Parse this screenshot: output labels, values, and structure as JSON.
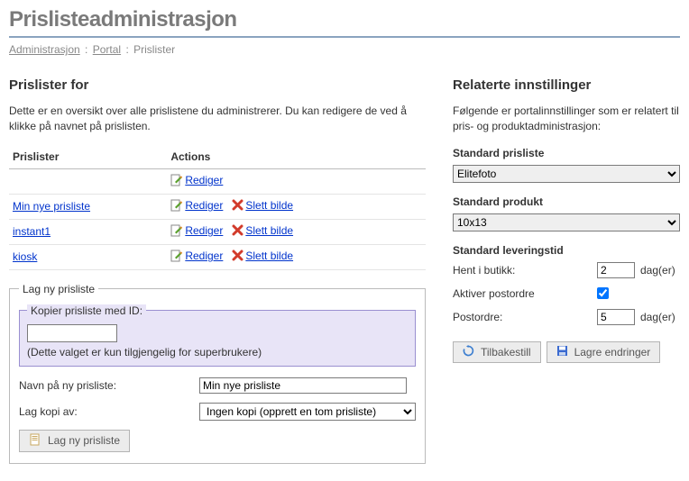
{
  "page_title": "Prislisteadministrasjon",
  "breadcrumb": {
    "admin": "Administrasjon",
    "portal": "Portal",
    "current": "Prislister"
  },
  "left": {
    "heading": "Prislister for",
    "intro": "Dette er en oversikt over alle prislistene du administrerer. Du kan redigere de ved å klikke på navnet på prislisten.",
    "table": {
      "col_name": "Prislister",
      "col_actions": "Actions",
      "rows": [
        {
          "name": "",
          "edit": "Rediger",
          "del": ""
        },
        {
          "name": "Min nye prisliste",
          "edit": "Rediger",
          "del": "Slett bilde"
        },
        {
          "name": "instant1",
          "edit": "Rediger",
          "del": "Slett bilde"
        },
        {
          "name": "kiosk",
          "edit": "Rediger",
          "del": "Slett bilde"
        }
      ]
    },
    "new_fieldset": {
      "legend": "Lag ny prisliste",
      "copy_legend": "Kopier prisliste med ID:",
      "copy_value": "",
      "copy_note": "(Dette valget er kun tilgjengelig for superbrukere)",
      "name_label": "Navn på ny prisliste:",
      "name_value": "Min nye prisliste",
      "copyof_label": "Lag kopi av:",
      "copyof_value": "Ingen kopi (opprett en tom prisliste)",
      "submit": "Lag ny prisliste"
    }
  },
  "right": {
    "heading": "Relaterte innstillinger",
    "intro": "Følgende er portalinnstillinger som er relatert til pris- og produktadministrasjon:",
    "std_pricelist_label": "Standard prisliste",
    "std_pricelist_value": "Elitefoto",
    "std_product_label": "Standard produkt",
    "std_product_value": "10x13",
    "std_delivery_label": "Standard leveringstid",
    "pickup_label": "Hent i butikk:",
    "pickup_value": "2",
    "days_suffix": "dag(er)",
    "mailorder_enable_label": "Aktiver postordre",
    "mailorder_enable": true,
    "mailorder_label": "Postordre:",
    "mailorder_value": "5",
    "reset": "Tilbakestill",
    "save": "Lagre endringer"
  }
}
